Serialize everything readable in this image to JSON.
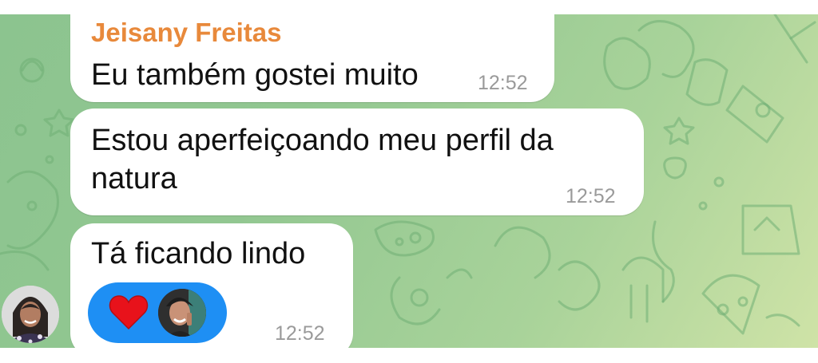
{
  "colors": {
    "sender_name": "#e8893b",
    "bubble": "#ffffff",
    "reaction_pill": "#1e8ff4",
    "heart": "#e8121b",
    "wallpaper": "#92c791"
  },
  "messages": [
    {
      "sender": "Jeisany Freitas",
      "text": "Eu também gostei muito",
      "time": "12:52"
    },
    {
      "text": "Estou aperfeiçoando meu perfil da natura",
      "time": "12:52"
    },
    {
      "text": "Tá ficando lindo",
      "time": "12:52",
      "reaction": {
        "icon": "heart-icon",
        "count_avatars": 1
      }
    }
  ],
  "icons": [
    "heart-icon",
    "avatar"
  ]
}
